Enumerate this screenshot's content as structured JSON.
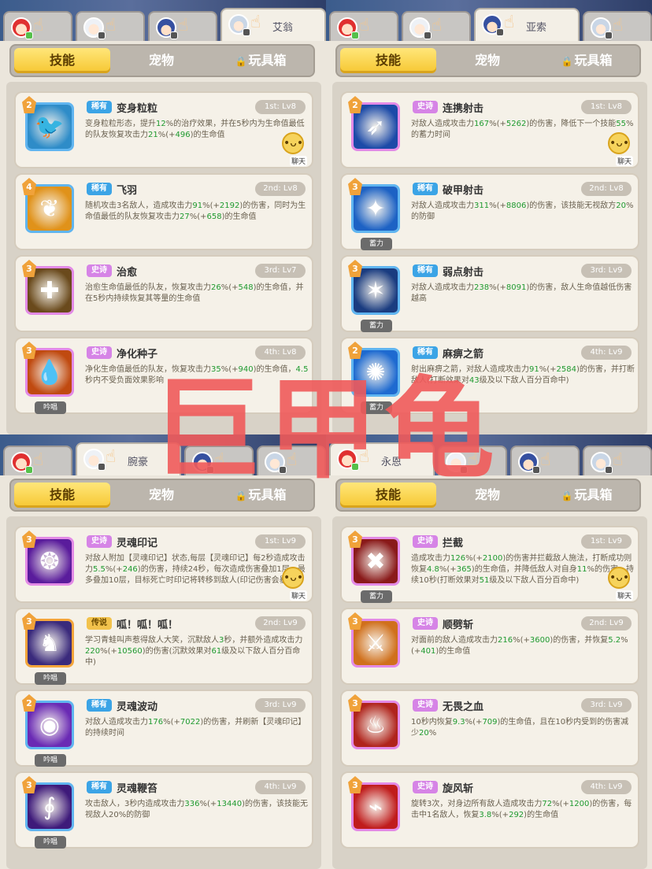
{
  "quadrants": [
    {
      "header_tabs": [
        {
          "avatar": "red",
          "dot": "green",
          "name": ""
        },
        {
          "avatar": "white",
          "dot": "gray",
          "name": ""
        },
        {
          "avatar": "blue",
          "dot": "gray",
          "name": ""
        },
        {
          "avatar": "silver",
          "dot": "gray",
          "name": "艾翁",
          "active": true
        }
      ],
      "subtabs": [
        "技能",
        "宠物",
        "玩具箱"
      ],
      "cards": [
        {
          "level": "2",
          "rarity": "稀有",
          "rarity_type": "rare",
          "name": "变身粒粒",
          "slot": "1st: Lv8",
          "desc_html": "变身粒粒形态，提升<b>12</b>%的治疗效果，并在5秒内为生命值最低的队友恢复攻击力<b>21</b>%(+<b>496</b>)的生命值",
          "under": "",
          "frame": "blue",
          "icon": "🐦",
          "icon_bg": "#2e8cc8",
          "chat": "聊天"
        },
        {
          "level": "4",
          "rarity": "稀有",
          "rarity_type": "rare",
          "name": "飞羽",
          "slot": "2nd: Lv8",
          "desc_html": "随机攻击3名敌人，造成攻击力<b>91</b>%(+<b>2192</b>)的伤害，同时为生命值最低的队友恢复攻击力<b>27</b>%(+<b>658</b>)的生命值",
          "under": "",
          "frame": "blue",
          "icon": "❦",
          "icon_bg": "#e0921a"
        },
        {
          "level": "3",
          "rarity": "史诗",
          "rarity_type": "epic",
          "name": "治愈",
          "slot": "3rd: Lv7",
          "desc_html": "治愈生命值最低的队友，恢复攻击力<b>26</b>%(+<b>548</b>)的生命值，并在5秒内持续恢复其等量的生命值",
          "under": "",
          "frame": "pink",
          "icon": "✚",
          "icon_bg": "#6a4a1c"
        },
        {
          "level": "3",
          "rarity": "史诗",
          "rarity_type": "epic",
          "name": "净化种子",
          "slot": "4th: Lv8",
          "desc_html": "净化生命值最低的队友，恢复攻击力<b>35</b>%(+<b>940</b>)的生命值，<b>4.5</b>秒内不受负面效果影响",
          "under": "吟唱",
          "frame": "pink",
          "icon": "💧",
          "icon_bg": "#c04a10"
        }
      ]
    },
    {
      "header_tabs": [
        {
          "avatar": "red",
          "dot": "green",
          "name": ""
        },
        {
          "avatar": "white",
          "dot": "gray",
          "name": ""
        },
        {
          "avatar": "blue",
          "dot": "gray",
          "name": "亚索",
          "active": true
        },
        {
          "avatar": "silver",
          "dot": "gray",
          "name": ""
        }
      ],
      "subtabs": [
        "技能",
        "宠物",
        "玩具箱"
      ],
      "cards": [
        {
          "level": "2",
          "rarity": "史诗",
          "rarity_type": "epic",
          "name": "连携射击",
          "slot": "1st: Lv8",
          "desc_html": "对敌人造成攻击力<b>167</b>%(+<b>5262</b>)的伤害，降低下一个技能<b>55</b>%的蓄力时间",
          "under": "",
          "frame": "pink",
          "icon": "➶",
          "icon_bg": "#1c4aa8",
          "chat": "聊天"
        },
        {
          "level": "3",
          "rarity": "稀有",
          "rarity_type": "rare",
          "name": "破甲射击",
          "slot": "2nd: Lv8",
          "desc_html": "对敌人造成攻击力<b>311</b>%(+<b>8806</b>)的伤害，该技能无视敌方<b>20</b>%的防御",
          "under": "蓄力",
          "frame": "blue",
          "icon": "✦",
          "icon_bg": "#1d62c4"
        },
        {
          "level": "3",
          "rarity": "稀有",
          "rarity_type": "rare",
          "name": "弱点射击",
          "slot": "3rd: Lv9",
          "desc_html": "对敌人造成攻击力<b>238</b>%(+<b>8091</b>)的伤害，敌人生命值越低伤害越高",
          "under": "蓄力",
          "frame": "blue",
          "icon": "✶",
          "icon_bg": "#1a3c80"
        },
        {
          "level": "2",
          "rarity": "稀有",
          "rarity_type": "rare",
          "name": "麻痹之箭",
          "slot": "4th: Lv9",
          "desc_html": "射出麻痹之箭，对敌人造成攻击力<b>91</b>%(+<b>2584</b>)的伤害，并打断敌人(打断效果对<b>43</b>级及以下敌人百分百命中)",
          "under": "蓄力",
          "frame": "blue",
          "icon": "✺",
          "icon_bg": "#1e6ad0"
        }
      ]
    },
    {
      "header_tabs": [
        {
          "avatar": "red",
          "dot": "green",
          "name": ""
        },
        {
          "avatar": "white",
          "dot": "gray",
          "name": "腕豪",
          "active": true
        },
        {
          "avatar": "blue",
          "dot": "gray",
          "name": ""
        },
        {
          "avatar": "silver",
          "dot": "gray",
          "name": ""
        }
      ],
      "subtabs": [
        "技能",
        "宠物",
        "玩具箱"
      ],
      "cards": [
        {
          "level": "3",
          "rarity": "史诗",
          "rarity_type": "epic",
          "name": "灵魂印记",
          "slot": "1st: Lv9",
          "desc_html": "对敌人附加【灵魂印记】状态,每层【灵魂印记】每2秒造成攻击力<b>5.5</b>%(+<b>246</b>)的伤害，持续24秒，每次造成伤害叠加1层，最多叠加10层，目标死亡时印记将转移到敌人(印记伤害会暴击)",
          "under": "",
          "frame": "pink",
          "icon": "❂",
          "icon_bg": "#5a1c9c",
          "chat": "聊天"
        },
        {
          "level": "3",
          "rarity": "传说",
          "rarity_type": "legend",
          "name": "呱！呱！呱！",
          "slot": "2nd: Lv9",
          "desc_html": "学习青蛙叫声惹得敌人大笑，沉默敌人<b>3</b>秒，并额外造成攻击力<b>220</b>%(+<b>10560</b>)的伤害(沉默效果对<b>61</b>级及以下敌人百分百命中)",
          "under": "吟唱",
          "frame": "orange",
          "icon": "♞",
          "icon_bg": "#3a2a7c"
        },
        {
          "level": "2",
          "rarity": "稀有",
          "rarity_type": "rare",
          "name": "灵魂波动",
          "slot": "3rd: Lv9",
          "desc_html": "对敌人造成攻击力<b>176</b>%(+<b>7022</b>)的伤害，并刷新【灵魂印记】的持续时间",
          "under": "吟唱",
          "frame": "blue",
          "icon": "◉",
          "icon_bg": "#6a2ab4"
        },
        {
          "level": "3",
          "rarity": "稀有",
          "rarity_type": "rare",
          "name": "灵魂鞭笞",
          "slot": "4th: Lv9",
          "desc_html": "攻击敌人，3秒内造成攻击力<b>336</b>%(+<b>13440</b>)的伤害，该技能无视敌人20%的防御",
          "under": "吟唱",
          "frame": "blue",
          "icon": "∮",
          "icon_bg": "#3e1a7a"
        }
      ]
    },
    {
      "header_tabs": [
        {
          "avatar": "red",
          "dot": "green",
          "name": "永恩",
          "active": true
        },
        {
          "avatar": "white",
          "dot": "gray",
          "name": ""
        },
        {
          "avatar": "blue",
          "dot": "gray",
          "name": ""
        },
        {
          "avatar": "silver",
          "dot": "gray",
          "name": ""
        }
      ],
      "subtabs": [
        "技能",
        "宠物",
        "玩具箱"
      ],
      "cards": [
        {
          "level": "3",
          "rarity": "史诗",
          "rarity_type": "epic",
          "name": "拦截",
          "slot": "1st: Lv9",
          "desc_html": "造成攻击力<b>126</b>%(+<b>2100</b>)的伤害并拦截敌人施法，打断成功则恢复<b>4.8</b>%(+<b>365</b>)的生命值，并降低敌人对自身<b>11</b>%的伤害，持续10秒(打断效果对<b>51</b>级及以下敌人百分百命中)",
          "under": "蓄力",
          "frame": "pink",
          "icon": "✖",
          "icon_bg": "#8a1a1a",
          "chat": "聊天"
        },
        {
          "level": "3",
          "rarity": "史诗",
          "rarity_type": "epic",
          "name": "顺劈斩",
          "slot": "2nd: Lv9",
          "desc_html": "对面前的敌人造成攻击力<b>216</b>%(+<b>3600</b>)的伤害，并恢复<b>5.2</b>%(+<b>401</b>)的生命值",
          "under": "",
          "frame": "pink",
          "icon": "⚔",
          "icon_bg": "#d0701c"
        },
        {
          "level": "3",
          "rarity": "史诗",
          "rarity_type": "epic",
          "name": "无畏之血",
          "slot": "3rd: Lv9",
          "desc_html": "10秒内恢复<b>9.3</b>%(+<b>709</b>)的生命值，且在10秒内受到的伤害减少<b>20</b>%",
          "under": "",
          "frame": "pink",
          "icon": "♨",
          "icon_bg": "#b0241c"
        },
        {
          "level": "3",
          "rarity": "史诗",
          "rarity_type": "epic",
          "name": "旋风斩",
          "slot": "4th: Lv9",
          "desc_html": "旋转3次，对身边所有敌人造成攻击力<b>72</b>%(+<b>1200</b>)的伤害，每击中1名敌人，恢复<b>3.8</b>%(+<b>292</b>)的生命值",
          "under": "",
          "frame": "pink",
          "icon": "⌁",
          "icon_bg": "#c01c1c"
        }
      ]
    }
  ],
  "watermark": "巨甲龟"
}
